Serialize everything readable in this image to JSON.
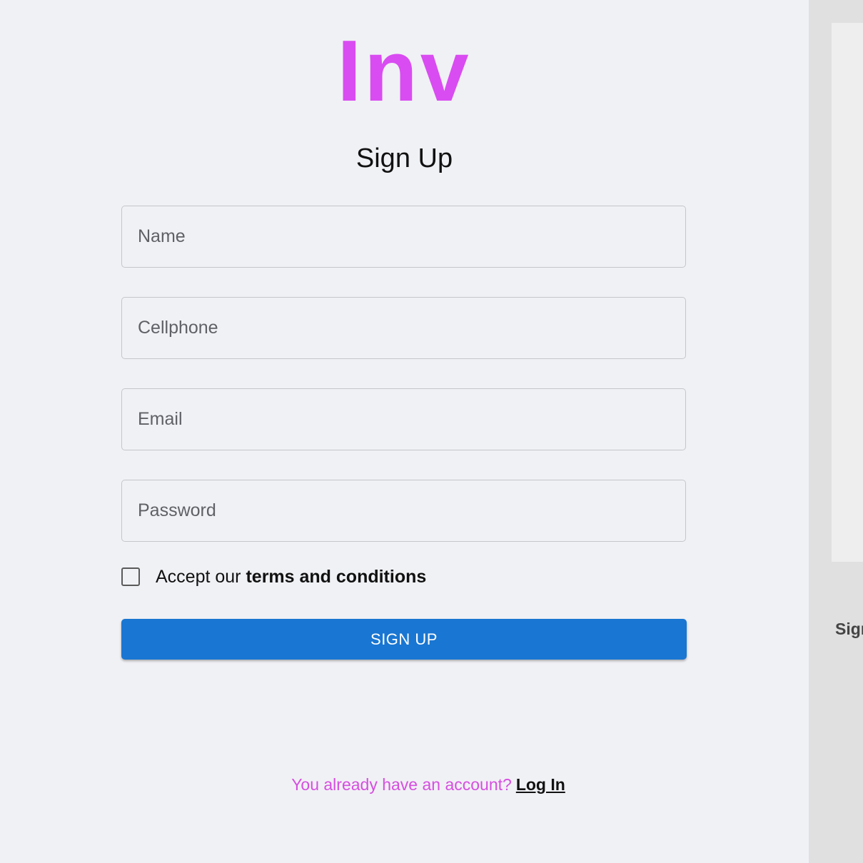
{
  "brand": {
    "logo_text": "Inv",
    "color": "#d94cf1"
  },
  "form": {
    "title": "Sign Up",
    "fields": {
      "name_placeholder": "Name",
      "cellphone_placeholder": "Cellphone",
      "email_placeholder": "Email",
      "password_placeholder": "Password"
    },
    "terms": {
      "prefix": "Accept our",
      "link": "terms and conditions",
      "checked": false
    },
    "submit_label": "SIGN UP",
    "submit_color": "#1976d2"
  },
  "footer": {
    "prompt": "You already have an account?",
    "login_label": "Log In"
  },
  "side_panel": {
    "label": "Sign"
  }
}
